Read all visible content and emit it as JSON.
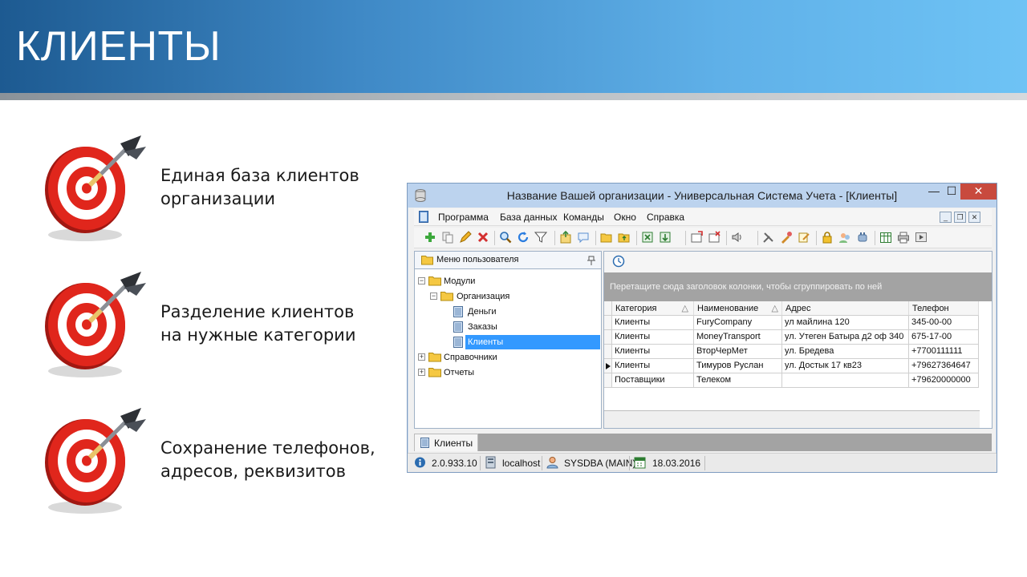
{
  "slide": {
    "title": "КЛИЕНТЫ"
  },
  "bullets": [
    {
      "text": "Единая база клиентов\nорганизации",
      "icon": "target-dart-icon"
    },
    {
      "text": "Разделение клиентов\nна нужные категории",
      "icon": "target-dart-icon"
    },
    {
      "text": "Сохранение телефонов,\nадресов, реквизитов",
      "icon": "target-dart-icon"
    }
  ],
  "app": {
    "title": "Название Вашей организации - Универсальная Система Учета - [Клиенты]",
    "window_controls": {
      "minimize": "—",
      "maximize": "☐",
      "close": "✕"
    },
    "menu": [
      "Программа",
      "База данных",
      "Команды",
      "Окно",
      "Справка"
    ],
    "mdi_controls": [
      "_",
      "❐",
      "✕"
    ],
    "nav": {
      "header": "Меню пользователя",
      "tree": [
        {
          "label": "Модули",
          "level": 0,
          "expander": "−"
        },
        {
          "label": "Организация",
          "level": 1,
          "expander": "−"
        },
        {
          "label": "Деньги",
          "level": 2
        },
        {
          "label": "Заказы",
          "level": 2
        },
        {
          "label": "Клиенты",
          "level": 2,
          "selected": true
        },
        {
          "label": "Справочники",
          "level": 0,
          "expander": "+"
        },
        {
          "label": "Отчеты",
          "level": 0,
          "expander": "+"
        }
      ]
    },
    "grid": {
      "group_hint": "Перетащите сюда заголовок колонки, чтобы сгруппировать по ней",
      "columns": [
        "Категория",
        "Наименование",
        "Адрес",
        "Телефон"
      ],
      "sort_marks": [
        "△",
        "△"
      ],
      "rows": [
        [
          "Клиенты",
          "FuryCompany",
          "ул майлина 120",
          "345-00-00"
        ],
        [
          "Клиенты",
          "MoneyTransport",
          "ул. Утеген Батыра д2 оф 340",
          "675-17-00"
        ],
        [
          "Клиенты",
          "ВторЧерМет",
          "ул. Бредева",
          "+7700111111"
        ],
        [
          "Клиенты",
          "Тимуров Руслан",
          "ул. Достык 17 кв23",
          "+79627364647"
        ],
        [
          "Поставщики",
          "Телеком",
          "",
          "+79620000000"
        ]
      ],
      "current_row": 3
    },
    "tab": "Клиенты",
    "status": {
      "version": "2.0.933.10",
      "host": "localhost",
      "user": "SYSDBA (MAIN)",
      "date": "18.03.2016"
    }
  },
  "colors": {
    "header_start": "#1d5a91",
    "header_end": "#6ec3f5",
    "selection": "#3399ff",
    "close_button": "#c84a3e"
  }
}
